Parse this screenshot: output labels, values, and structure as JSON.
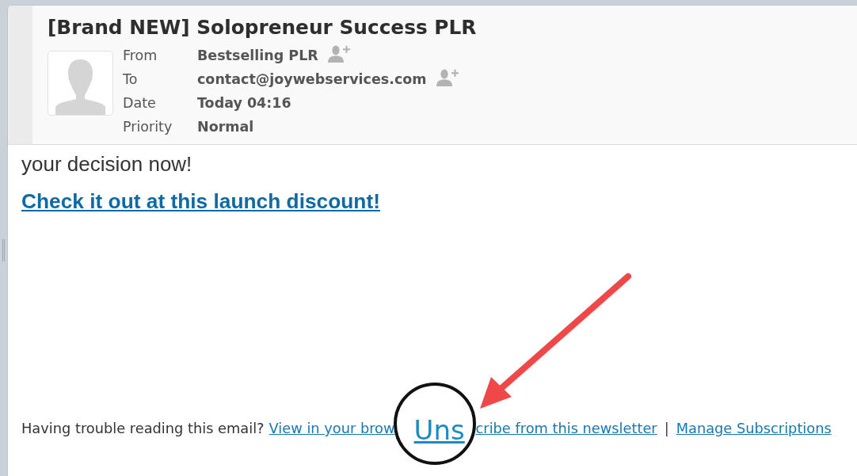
{
  "header": {
    "subject": "[Brand NEW] Solopreneur Success PLR",
    "fields": [
      {
        "label": "From",
        "value": "Bestselling PLR",
        "add_contact": true
      },
      {
        "label": "To",
        "value": "contact@joywebservices.com",
        "add_contact": true
      },
      {
        "label": "Date",
        "value": "Today 04:16",
        "add_contact": false
      },
      {
        "label": "Priority",
        "value": "Normal",
        "add_contact": false
      }
    ]
  },
  "body": {
    "paragraph": "your decision now!",
    "link": "Check it out at this launch discount!"
  },
  "footer": {
    "items": [
      {
        "kind": "text",
        "text": "Having trouble reading this email?"
      },
      {
        "kind": "link",
        "text": "View in your brow"
      },
      {
        "kind": "magnifier",
        "text": "Uns"
      },
      {
        "kind": "link",
        "text": "cribe from this newsletter"
      },
      {
        "kind": "separator",
        "text": "|"
      },
      {
        "kind": "link",
        "text": "Manage Subscriptions"
      }
    ]
  }
}
